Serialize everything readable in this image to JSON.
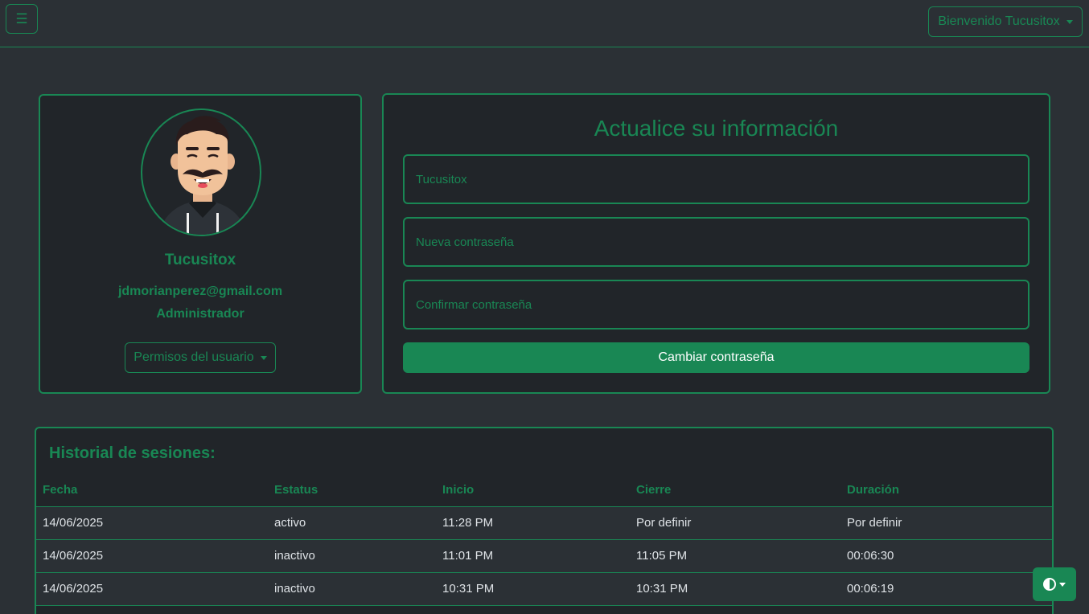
{
  "navbar": {
    "menu_icon": "hamburger-icon",
    "menu_glyph": "☰",
    "welcome_label": "Bienvenido Tucusitox"
  },
  "profile": {
    "name": "Tucusitox",
    "email": "jdmorianperez@gmail.com",
    "role": "Administrador",
    "permissions_label": "Permisos del usuario"
  },
  "update_form": {
    "title": "Actualice su información",
    "username_value": "Tucusitox",
    "new_password_placeholder": "Nueva contraseña",
    "confirm_password_placeholder": "Confirmar contraseña",
    "submit_label": "Cambiar contraseña"
  },
  "history": {
    "title": "Historial de sesiones:",
    "columns": [
      "Fecha",
      "Estatus",
      "Inicio",
      "Cierre",
      "Duración"
    ],
    "rows": [
      [
        "14/06/2025",
        "activo",
        "11:28 PM",
        "Por definir",
        "Por definir"
      ],
      [
        "14/06/2025",
        "inactivo",
        "11:01 PM",
        "11:05 PM",
        "00:06:30"
      ],
      [
        "14/06/2025",
        "inactivo",
        "10:31 PM",
        "10:31 PM",
        "00:06:19"
      ]
    ]
  },
  "theme_toggle": {
    "icon": "contrast-icon"
  },
  "colors": {
    "accent": "#198754",
    "background": "#2b3035",
    "card": "#212529"
  }
}
